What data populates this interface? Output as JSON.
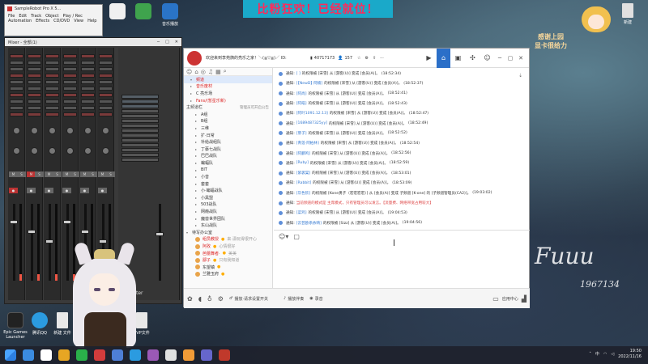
{
  "desktop": {
    "banner": "比粉狂欢！已经就位！",
    "deco_text_line1": "感谢上园",
    "deco_text_line2": "显卡很给力",
    "signature": "Fuuu",
    "signature_number": "1967134",
    "icons": [
      {
        "label": "",
        "color": "#f0f0f0"
      },
      {
        "label": "",
        "color": "#3fa34d"
      },
      {
        "label": "",
        "color": "#2a74c7"
      },
      {
        "label": "",
        "color": "#6b6b6b"
      },
      {
        "label": "",
        "color": "#e0e0e0"
      }
    ],
    "top_icon_label": "音乐播放",
    "file_icon_label": "新建",
    "bottom_icons": [
      {
        "label": "Epic Games Launcher",
        "color": "#222222"
      },
      {
        "label": "腾讯QQ",
        "color": "#2b9be0"
      },
      {
        "label": "新建 文件",
        "color": "#e8e8e8"
      },
      {
        "label": "PVP文件",
        "color": "#e8e8e8"
      }
    ]
  },
  "daw": {
    "main_title": "SampleRobot Pro X 5...",
    "menu": [
      "File",
      "Edit",
      "Track",
      "Object",
      "Play / Rec",
      "Automation",
      "Effects",
      "CD/DVD",
      "View",
      "Help"
    ],
    "mixer_title": "Mixer - 全部(1)",
    "mixer_ctrls": [
      "─",
      "□",
      "✕"
    ],
    "strip_buttons": [
      "M",
      "S",
      "M",
      "S",
      "M",
      "S",
      "M",
      "S"
    ],
    "master_label": "Master"
  },
  "chat": {
    "title": "欢迎来到李苑旖的亮乐之家！＼(≧▽≦)／ ID:",
    "room_id": "40717173",
    "viewers": "157",
    "sidebar": {
      "items": [
        {
          "label": "频道",
          "tri": "▾",
          "red": true,
          "active": true
        },
        {
          "label": "音乐废材",
          "tri": "▸",
          "red": true
        },
        {
          "label": "C 亮乐场",
          "tri": "▸",
          "red": false
        },
        {
          "label": "Fans/(暂星乐新)",
          "tri": "▸",
          "red": true
        }
      ],
      "section_head": "主频道栏",
      "section_sub": "管理员可开启公告",
      "channels": [
        "A组",
        "B组",
        "三维",
        "扩·日常",
        "补给战组队",
        "丁蔡七战队",
        "巴巴战队",
        "蝙蝠队",
        "BIT",
        "小音",
        "套套",
        "小·蝙蝠战队",
        "小黑盟",
        "503战队",
        "网瘾战队",
        "魔兽世界团队",
        "东山战队"
      ],
      "talk_head": "待写办公室",
      "talk_users": [
        {
          "name": "组员教授",
          "sub": "来·潇玩得很开心"
        },
        {
          "name": "阿孜",
          "sub": "心情很好"
        },
        {
          "name": "芭蕾舞者·",
          "sub": "美美"
        },
        {
          "name": "鄙子",
          "sub": "只有我知道"
        },
        {
          "name": "东望镇",
          "sub": ""
        },
        {
          "name": "兰雅玉府",
          "sub": ""
        }
      ]
    },
    "messages": [
      {
        "tag": "通知:",
        "name": "[      ]",
        "text": "的权限被 [宋雪] 从 [游客(U)] 变成 [会员(A)]。",
        "time": "(18:52:34)"
      },
      {
        "tag": "通知:",
        "name": "[【NewD】·阿楠]",
        "text": "的权限被 [宋雪] 从 [游客(U)] 变成 [会员(A)]。",
        "time": "(18:52:37)"
      },
      {
        "tag": "通知:",
        "name": "[阿尚]",
        "text": "的权限被 [宋雪] 从 [游客(U)] 变成 [会员(A)]。",
        "time": "(18:52:41)"
      },
      {
        "tag": "通知:",
        "name": "[阿皓]",
        "text": "的权限被 [宋雪] 从 [游客(U)] 变成 [会员(A)]。",
        "time": "(18:52:43)"
      },
      {
        "tag": "通知:",
        "name": "[阿叶1091.12.13]",
        "text": "的权限被 [宋雪] 从 [游客(U)] 变成 [会员(A)]。",
        "time": "(18:52:47)"
      },
      {
        "tag": "通知:",
        "name": "[1689487325yy]",
        "text": "的权限被 [宋雪] 从 [游客(U)] 变成 [会员(A)]。",
        "time": "(18:52:49)"
      },
      {
        "tag": "通知:",
        "name": "[芽子]",
        "text": "的权限被 [宋雪] 从 [游客(U)] 变成 [会员(A)]。",
        "time": "(18:52:52)"
      },
      {
        "tag": "通知:",
        "name": "[青莲·阿柏林]",
        "text": "的权限被 [宋雪] 从 [游客(U)] 变成 [会员(A)]。",
        "time": "(18:52:54)"
      },
      {
        "tag": "通知:",
        "name": "[阿麟鸣]",
        "text": "的权限被 [宋雪] 从 [游客(U)] 变成 [会员(A)]。",
        "time": "(18:52:56)"
      },
      {
        "tag": "通知:",
        "name": "[Ruby]",
        "text": "的权限被 [宋雪] 从 [游客(U)] 变成 [会员(A)]。",
        "time": "(18:52:59)"
      },
      {
        "tag": "通知:",
        "name": "[紫袭棠]",
        "text": "的权限被 [宋雪] 从 [游客(U)] 变成 [会员(A)]。",
        "time": "(18:53:01)"
      },
      {
        "tag": "通知:",
        "name": "[Rabbit]",
        "text": "的权限被 [宋雪] 从 [游客(U)] 变成 [会员(A)]。",
        "time": "(18:53:09)"
      },
      {
        "tag": "通知:",
        "name": "[灰色钦]",
        "text": "的权限被 [Kone勇子（宏宏宏宏）] 从 [会员(A)] 变成 子频道 [K-one] 的 [子频道管理员(CA2)]。",
        "time": "(19:03:02)"
      },
      {
        "tag": "通知:",
        "name": "",
        "text": "当前频道的模式是 主席模式，只有管理员可以发言。【流量费、网络带宽占用较大】",
        "time": "",
        "red": true
      },
      {
        "tag": "通知:",
        "name": "[菜鸡]",
        "text": "的权限被 [宋雪] 从 [游客(U)] 变成 [会员(A)]。",
        "time": "(19:04:53)"
      },
      {
        "tag": "通知:",
        "name": "[云芸欧系依晴]",
        "text": "的权限被 [Sizz] 从 [游客(U)] 变成 [会员(A)]。",
        "time": "(19:04:56)"
      }
    ],
    "bottom": {
      "left_label": "播放·请求设置开关",
      "play_label": "播放伴奏",
      "record_label": "录音",
      "right_label": "应用中心"
    }
  },
  "taskbar": {
    "time": "19:50",
    "date": "2022/11/16",
    "lang": "中",
    "icons": [
      "#3b8be0",
      "#ffffff",
      "#e7a623",
      "#2ab04a",
      "#d23c3c",
      "#4e7fd6",
      "#2b9be0",
      "#9b59b6",
      "#e0e0e0",
      "#f29b37",
      "#66c",
      "#c0392b"
    ]
  }
}
